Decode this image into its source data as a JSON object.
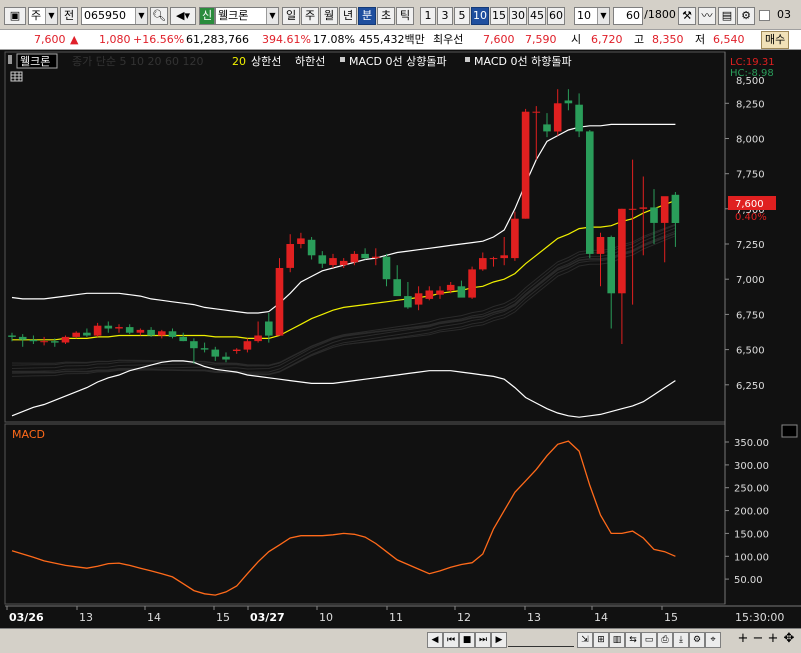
{
  "toolbar": {
    "market": "주",
    "all_label": "전",
    "code": "065950",
    "credit_badge": "신",
    "stock_name": "웰크론",
    "periods": [
      "일",
      "주",
      "월",
      "년",
      "분",
      "초",
      "틱"
    ],
    "selected_period": "분",
    "intervals": [
      "1",
      "3",
      "5",
      "10",
      "15",
      "30",
      "45",
      "60"
    ],
    "selected_interval": "10",
    "interval_value": "10",
    "count_value": "60",
    "count_max": "/1800",
    "checkbox_label": "03"
  },
  "info": {
    "price": "7,600",
    "direction": "▲",
    "change": "1,080",
    "change_pct": "+16.56%",
    "volume": "61,283,766",
    "vol_ratio": "394.61%",
    "turnover": "17.08%",
    "amount": "455,432백만",
    "best_label": "최우선",
    "ask": "7,600",
    "bid": "7,590",
    "open_label": "시",
    "open": "6,720",
    "high_label": "고",
    "high": "8,350",
    "low_label": "저",
    "low": "6,540",
    "trade_label": "매수"
  },
  "legend": {
    "name": "웰크론",
    "ma_label": "종가 단순 5 10 20 60 120",
    "period": "20",
    "upper": "상한선",
    "lower": "하한선",
    "macd_up": "MACD 0선 상향돌파",
    "macd_down": "MACD 0선 하향돌파"
  },
  "colors": {
    "up": "#e02020",
    "down": "#2a9d5a",
    "mid_band": "#f0f000",
    "band": "#ffffff",
    "macd": "#ff6a1a",
    "bg": "#111111"
  },
  "price_axis": {
    "ticks": [
      "8,250",
      "8,000",
      "7,750",
      "7,500",
      "7,250",
      "7,000",
      "6,750",
      "6,500",
      "6,250"
    ],
    "top_label": "8,500",
    "current": "7,600",
    "current_pct": "0.40%",
    "lc": "LC:19.31",
    "hc": "HC:-8.98"
  },
  "macd_panel": {
    "title": "MACD",
    "ticks": [
      "350.00",
      "300.00",
      "250.00",
      "200.00",
      "150.00",
      "100.00",
      "50.00"
    ]
  },
  "time_axis": {
    "labels": [
      "03/26",
      "13",
      "14",
      "15",
      "03/27",
      "10",
      "11",
      "12",
      "13",
      "14",
      "15"
    ],
    "end_time": "15:30:00"
  },
  "chart_data": {
    "type": "candlestick",
    "candles": [
      [
        6600,
        6620,
        6560,
        6590
      ],
      [
        6590,
        6610,
        6520,
        6570
      ],
      [
        6570,
        6600,
        6540,
        6560
      ],
      [
        6560,
        6590,
        6530,
        6560
      ],
      [
        6560,
        6580,
        6520,
        6550
      ],
      [
        6550,
        6600,
        6540,
        6590
      ],
      [
        6590,
        6630,
        6580,
        6620
      ],
      [
        6620,
        6650,
        6590,
        6600
      ],
      [
        6600,
        6690,
        6590,
        6670
      ],
      [
        6670,
        6700,
        6620,
        6650
      ],
      [
        6650,
        6680,
        6620,
        6660
      ],
      [
        6660,
        6680,
        6610,
        6620
      ],
      [
        6620,
        6650,
        6600,
        6640
      ],
      [
        6640,
        6660,
        6590,
        6600
      ],
      [
        6600,
        6640,
        6580,
        6630
      ],
      [
        6630,
        6650,
        6580,
        6590
      ],
      [
        6590,
        6620,
        6560,
        6560
      ],
      [
        6560,
        6580,
        6400,
        6510
      ],
      [
        6510,
        6550,
        6480,
        6500
      ],
      [
        6500,
        6520,
        6420,
        6450
      ],
      [
        6450,
        6480,
        6410,
        6430
      ],
      [
        6490,
        6510,
        6470,
        6500
      ],
      [
        6500,
        6580,
        6480,
        6560
      ],
      [
        6560,
        6700,
        6550,
        6600
      ],
      [
        6700,
        6760,
        6550,
        6600
      ],
      [
        6600,
        7150,
        6600,
        7080
      ],
      [
        7080,
        7320,
        7050,
        7250
      ],
      [
        7250,
        7330,
        7220,
        7290
      ],
      [
        7280,
        7300,
        7140,
        7170
      ],
      [
        7170,
        7200,
        7080,
        7110
      ],
      [
        7100,
        7180,
        7080,
        7150
      ],
      [
        7100,
        7150,
        7080,
        7130
      ],
      [
        7120,
        7200,
        7100,
        7180
      ],
      [
        7180,
        7220,
        7140,
        7150
      ],
      [
        7150,
        7220,
        7100,
        7160
      ],
      [
        7160,
        7180,
        6950,
        7000
      ],
      [
        7000,
        7100,
        6980,
        6880
      ],
      [
        6880,
        6980,
        6790,
        6800
      ],
      [
        6820,
        6950,
        6780,
        6900
      ],
      [
        6860,
        6950,
        6850,
        6920
      ],
      [
        6890,
        6950,
        6860,
        6920
      ],
      [
        6920,
        6980,
        6900,
        6960
      ],
      [
        6950,
        6990,
        6870,
        6870
      ],
      [
        6870,
        7090,
        6860,
        7070
      ],
      [
        7070,
        7190,
        7060,
        7150
      ],
      [
        7150,
        7160,
        7090,
        7150
      ],
      [
        7150,
        7300,
        7100,
        7170
      ],
      [
        7150,
        7480,
        7130,
        7430
      ],
      [
        7430,
        8210,
        7430,
        8190
      ],
      [
        8190,
        8230,
        7850,
        8190
      ],
      [
        8100,
        8180,
        8010,
        8050
      ],
      [
        8050,
        8350,
        8020,
        8250
      ],
      [
        8270,
        8350,
        8200,
        8250
      ],
      [
        8240,
        8320,
        8010,
        8050
      ],
      [
        8050,
        8060,
        7150,
        7180
      ],
      [
        7180,
        7330,
        6950,
        7300
      ],
      [
        7300,
        7310,
        6650,
        6900
      ],
      [
        6900,
        7500,
        6540,
        7500
      ],
      [
        7500,
        7850,
        6820,
        7500
      ],
      [
        7500,
        7730,
        7170,
        7510
      ],
      [
        7510,
        7640,
        7250,
        7400
      ],
      [
        7400,
        7550,
        7120,
        7590
      ],
      [
        7600,
        7620,
        7230,
        7400
      ]
    ],
    "upper_band": [
      6870,
      6860,
      6860,
      6860,
      6870,
      6880,
      6890,
      6900,
      6900,
      6900,
      6900,
      6890,
      6880,
      6860,
      6850,
      6840,
      6830,
      6820,
      6800,
      6790,
      6780,
      6770,
      6760,
      6760,
      6770,
      6830,
      6900,
      6980,
      7020,
      7060,
      7080,
      7100,
      7120,
      7140,
      7150,
      7170,
      7190,
      7200,
      7210,
      7220,
      7230,
      7240,
      7250,
      7260,
      7270,
      7300,
      7350,
      7500,
      7680,
      7850,
      7980,
      8020,
      8060,
      8080,
      8090,
      8090,
      8100,
      8100,
      8100,
      8100,
      8100,
      8100,
      8100
    ],
    "mid_band": [
      6570,
      6570,
      6570,
      6570,
      6570,
      6580,
      6580,
      6580,
      6590,
      6590,
      6600,
      6600,
      6600,
      6600,
      6600,
      6600,
      6600,
      6600,
      6600,
      6590,
      6590,
      6590,
      6580,
      6580,
      6580,
      6600,
      6640,
      6680,
      6720,
      6750,
      6780,
      6800,
      6810,
      6820,
      6830,
      6840,
      6850,
      6860,
      6870,
      6880,
      6900,
      6910,
      6920,
      6940,
      6950,
      6980,
      7000,
      7040,
      7110,
      7170,
      7230,
      7290,
      7320,
      7360,
      7370,
      7370,
      7380,
      7410,
      7430,
      7470,
      7500,
      7530,
      7560
    ],
    "lower_band": [
      6030,
      6060,
      6090,
      6110,
      6140,
      6170,
      6200,
      6230,
      6270,
      6300,
      6320,
      6350,
      6370,
      6390,
      6410,
      6420,
      6420,
      6410,
      6380,
      6360,
      6350,
      6340,
      6320,
      6310,
      6300,
      6290,
      6280,
      6270,
      6260,
      6260,
      6260,
      6270,
      6280,
      6290,
      6300,
      6310,
      6320,
      6330,
      6340,
      6350,
      6350,
      6350,
      6340,
      6330,
      6320,
      6310,
      6290,
      6230,
      6160,
      6120,
      6080,
      6050,
      6030,
      6020,
      6030,
      6040,
      6060,
      6080,
      6100,
      6130,
      6180,
      6230,
      6280
    ],
    "macd": [
      112,
      105,
      98,
      90,
      85,
      80,
      77,
      74,
      78,
      84,
      85,
      80,
      74,
      68,
      62,
      55,
      40,
      25,
      18,
      15,
      22,
      35,
      62,
      88,
      110,
      125,
      140,
      145,
      145,
      145,
      147,
      150,
      148,
      142,
      128,
      110,
      92,
      82,
      72,
      62,
      68,
      76,
      82,
      86,
      105,
      160,
      200,
      240,
      265,
      290,
      320,
      345,
      352,
      330,
      255,
      190,
      150,
      150,
      155,
      140,
      115,
      110,
      100
    ],
    "price_range": [
      6000,
      8600
    ],
    "macd_range": [
      0,
      385
    ]
  }
}
